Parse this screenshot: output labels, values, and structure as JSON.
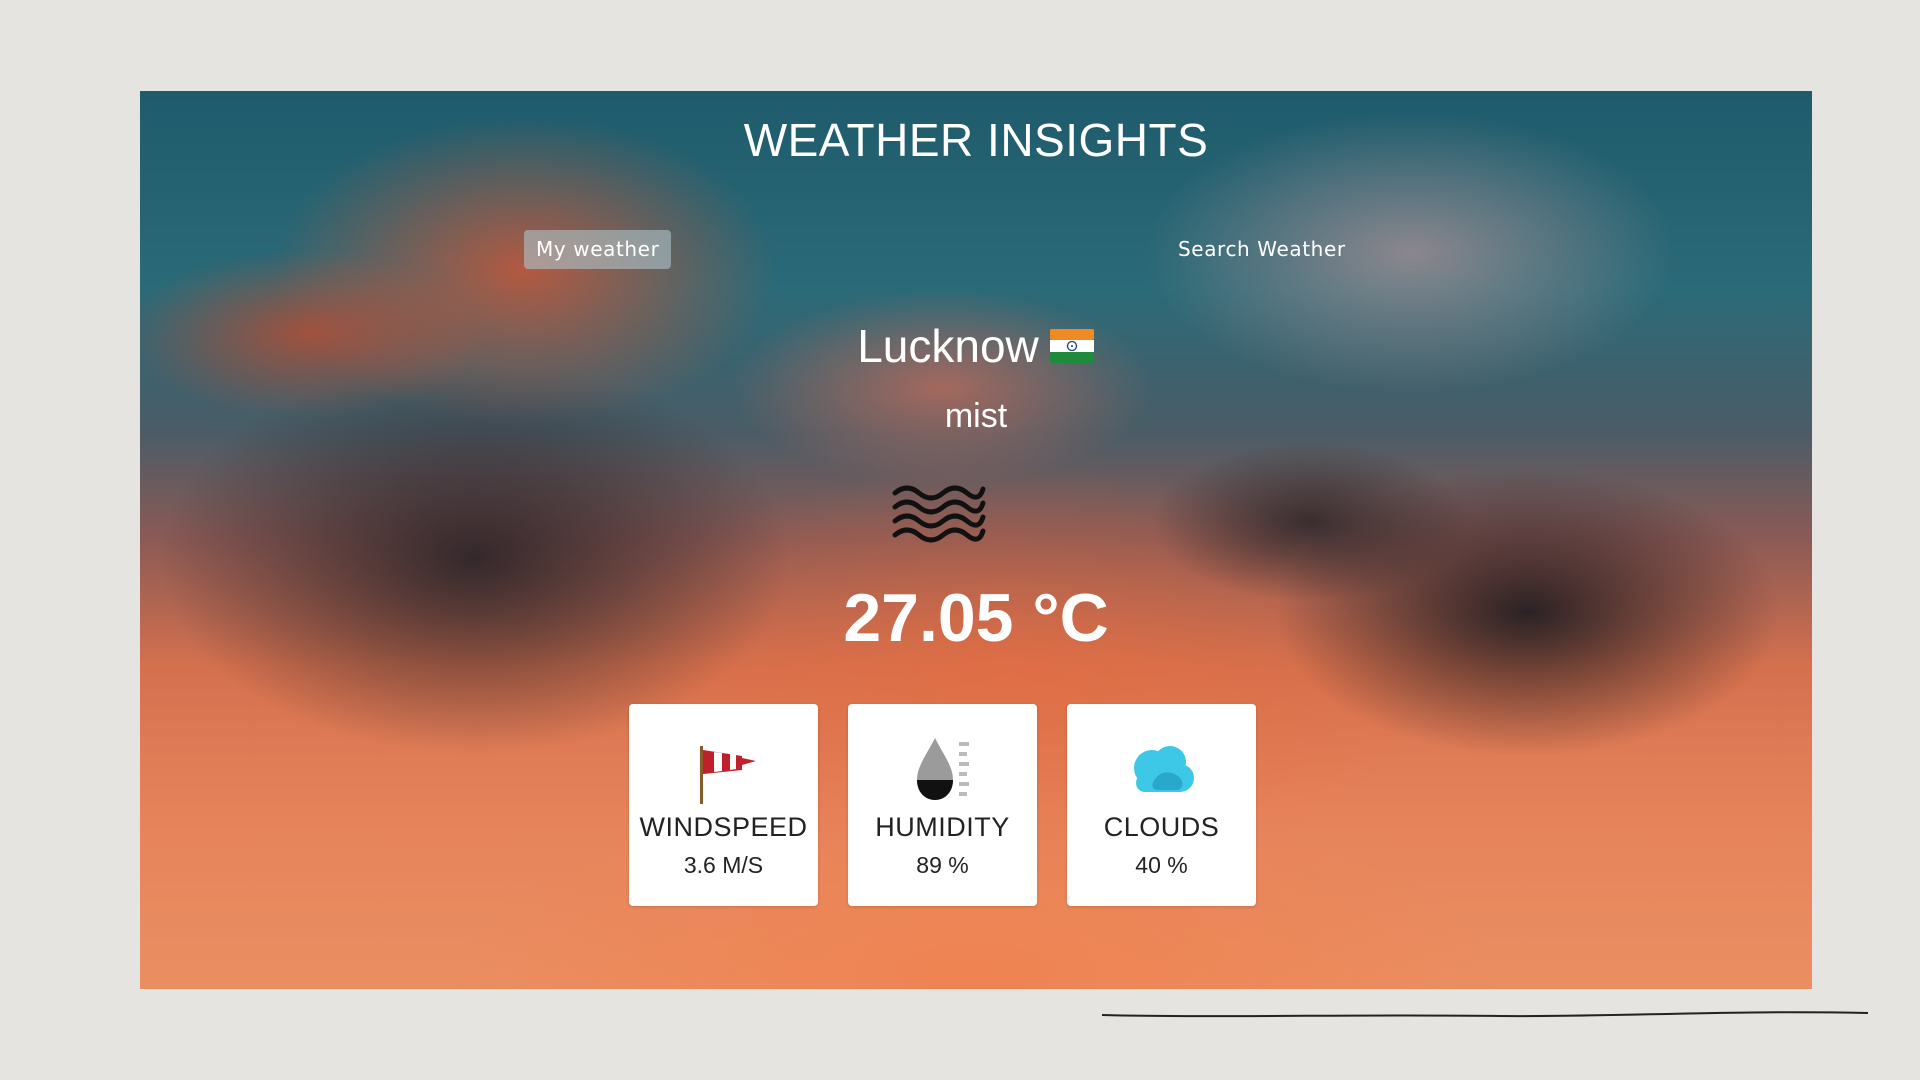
{
  "app": {
    "title": "WEATHER INSIGHTS"
  },
  "nav": {
    "my_weather": "My weather",
    "search_weather": "Search Weather"
  },
  "weather": {
    "city": "Lucknow",
    "country_flag": "india-flag-icon",
    "condition": "mist",
    "condition_icon": "mist-icon",
    "temperature": "27.05 °C"
  },
  "stats": [
    {
      "label": "WINDSPEED",
      "value": "3.6 M/S",
      "icon": "windsock-icon"
    },
    {
      "label": "HUMIDITY",
      "value": "89 %",
      "icon": "humidity-drop-icon"
    },
    {
      "label": "CLOUDS",
      "value": "40 %",
      "icon": "cloud-icon"
    }
  ],
  "colors": {
    "page_background": "#e5e4e0",
    "text_on_sky": "#ffffff",
    "active_tab": "#adc4cc",
    "card_background": "#ffffff",
    "cloud_icon": "#3cc8e6"
  }
}
